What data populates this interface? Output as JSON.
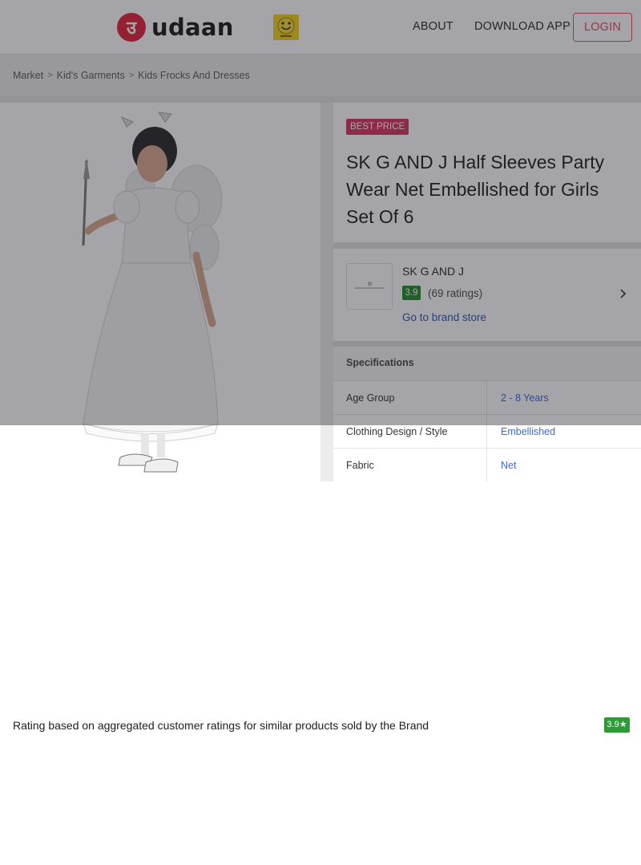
{
  "header": {
    "logo_mark": "उ",
    "logo_text": "udaan",
    "nav": {
      "about": "ABOUT",
      "download": "DOWNLOAD APP"
    },
    "login": "LOGIN"
  },
  "breadcrumb": [
    "Market",
    "Kid's Garments",
    "Kids Frocks And Dresses"
  ],
  "product": {
    "badge": "BEST PRICE",
    "title": "SK G AND J Half Sleeves Party Wear Net Embellished for Girls Set Of 6"
  },
  "brand": {
    "name": "SK G AND J",
    "rating": "3.9",
    "ratings_count": "(69 ratings)",
    "store_link": "Go to brand store"
  },
  "specifications": {
    "title": "Specifications",
    "rows": [
      {
        "label": "Age Group",
        "value": "2 - 8 Years"
      },
      {
        "label": "Clothing Design / Style",
        "value": "Embellished"
      },
      {
        "label": "Fabric",
        "value": "Net"
      }
    ]
  },
  "rating_sheet": {
    "text": "Rating based on aggregated customer ratings for similar products sold by the Brand",
    "badge": "3.9★"
  },
  "colors": {
    "brand_red": "#e3243a",
    "badge_pink": "#d8345f",
    "rating_green": "#248b2a",
    "link_blue": "#2a57b8"
  },
  "icons": [
    "udaan-logo-icon",
    "smiley-promo-icon",
    "chevron-right-icon",
    "brand-logo-placeholder-icon"
  ]
}
